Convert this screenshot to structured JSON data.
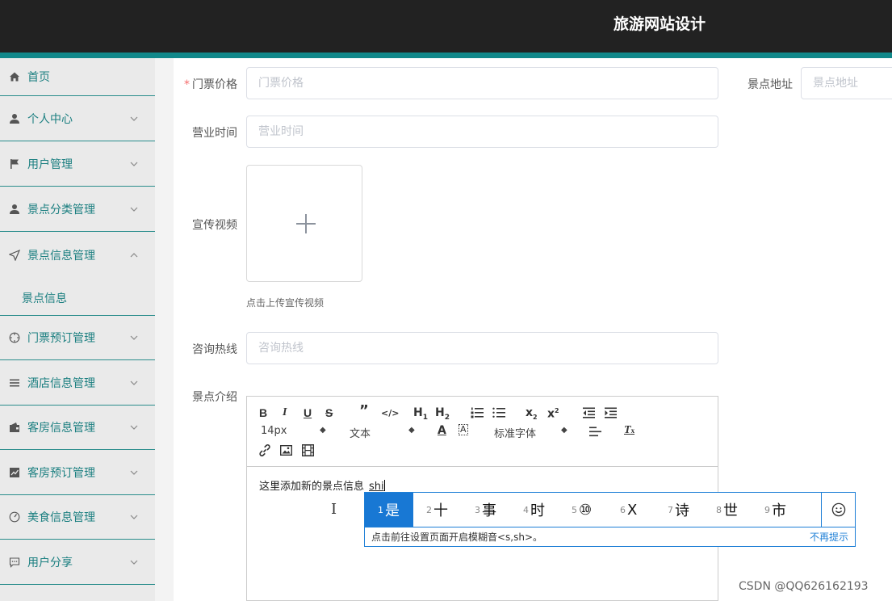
{
  "header": {
    "title": "旅游网站设计"
  },
  "sidebar": {
    "items": [
      {
        "label": "首页",
        "icon": "home-icon"
      },
      {
        "label": "个人中心",
        "icon": "user-icon"
      },
      {
        "label": "用户管理",
        "icon": "flag-icon"
      },
      {
        "label": "景点分类管理",
        "icon": "user-icon"
      },
      {
        "label": "景点信息管理",
        "icon": "navigation-icon"
      },
      {
        "label": "门票预订管理",
        "icon": "compass-icon"
      },
      {
        "label": "酒店信息管理",
        "icon": "list-icon"
      },
      {
        "label": "客房信息管理",
        "icon": "wallet-icon"
      },
      {
        "label": "客房预订管理",
        "icon": "chart-icon"
      },
      {
        "label": "美食信息管理",
        "icon": "gauge-icon"
      },
      {
        "label": "用户分享",
        "icon": "chat-icon"
      }
    ],
    "sub_item": "景点信息"
  },
  "form": {
    "ticket_price": {
      "label": "门票价格",
      "placeholder": "门票价格",
      "required_mark": "*"
    },
    "address": {
      "label": "景点地址",
      "placeholder": "景点地址"
    },
    "hours": {
      "label": "营业时间",
      "placeholder": "营业时间"
    },
    "video": {
      "label": "宣传视频",
      "tip": "点击上传宣传视频"
    },
    "hotline": {
      "label": "咨询热线",
      "placeholder": "咨询热线"
    },
    "intro": {
      "label": "景点介绍"
    }
  },
  "editor": {
    "font_size": "14px",
    "block_type": "文本",
    "font_family": "标准字体",
    "text": "这里添加新的景点信息",
    "composition": "shi"
  },
  "ime": {
    "candidates": [
      {
        "num": "1",
        "ch": "是"
      },
      {
        "num": "2",
        "ch": "十"
      },
      {
        "num": "3",
        "ch": "事"
      },
      {
        "num": "4",
        "ch": "时"
      },
      {
        "num": "5",
        "ch": "⑩"
      },
      {
        "num": "6",
        "ch": "X"
      },
      {
        "num": "7",
        "ch": "诗"
      },
      {
        "num": "8",
        "ch": "世"
      },
      {
        "num": "9",
        "ch": "市"
      }
    ],
    "hint": "点击前往设置页面开启模糊音<s,sh>。",
    "dismiss": "不再提示"
  },
  "watermark": "CSDN @QQ626162193",
  "colors": {
    "header_bg": "#222222",
    "accent": "#11888a",
    "menu_text": "#1b7f80",
    "ime_blue": "#1878d4"
  }
}
